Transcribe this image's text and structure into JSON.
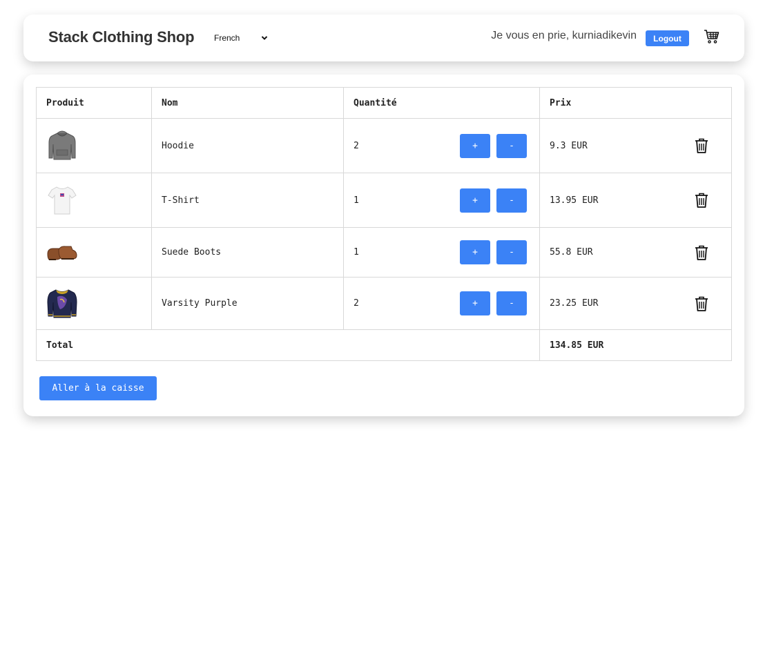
{
  "header": {
    "brand": "Stack Clothing Shop",
    "language": {
      "selected": "French"
    },
    "greeting": "Je vous en prie, kurniadikevin",
    "logout_label": "Logout",
    "cart_icon": "shopping-cart-icon"
  },
  "cart": {
    "columns": {
      "product": "Produit",
      "name": "Nom",
      "quantity": "Quantité",
      "price": "Prix"
    },
    "items": [
      {
        "name": "Hoodie",
        "quantity": "2",
        "price": "9.3 EUR",
        "image_icon": "hoodie-icon"
      },
      {
        "name": "T-Shirt",
        "quantity": "1",
        "price": "13.95 EUR",
        "image_icon": "tshirt-icon"
      },
      {
        "name": "Suede Boots",
        "quantity": "1",
        "price": "55.8 EUR",
        "image_icon": "boots-icon"
      },
      {
        "name": "Varsity Purple",
        "quantity": "2",
        "price": "23.25 EUR",
        "image_icon": "varsity-jacket-icon"
      }
    ],
    "increment_label": "+",
    "decrement_label": "-",
    "delete_icon": "trash-icon",
    "total_label": "Total",
    "total_value": "134.85 EUR",
    "checkout_label": "Aller à la caisse"
  },
  "colors": {
    "accent": "#3b82f6",
    "border": "#d8d8d8"
  }
}
